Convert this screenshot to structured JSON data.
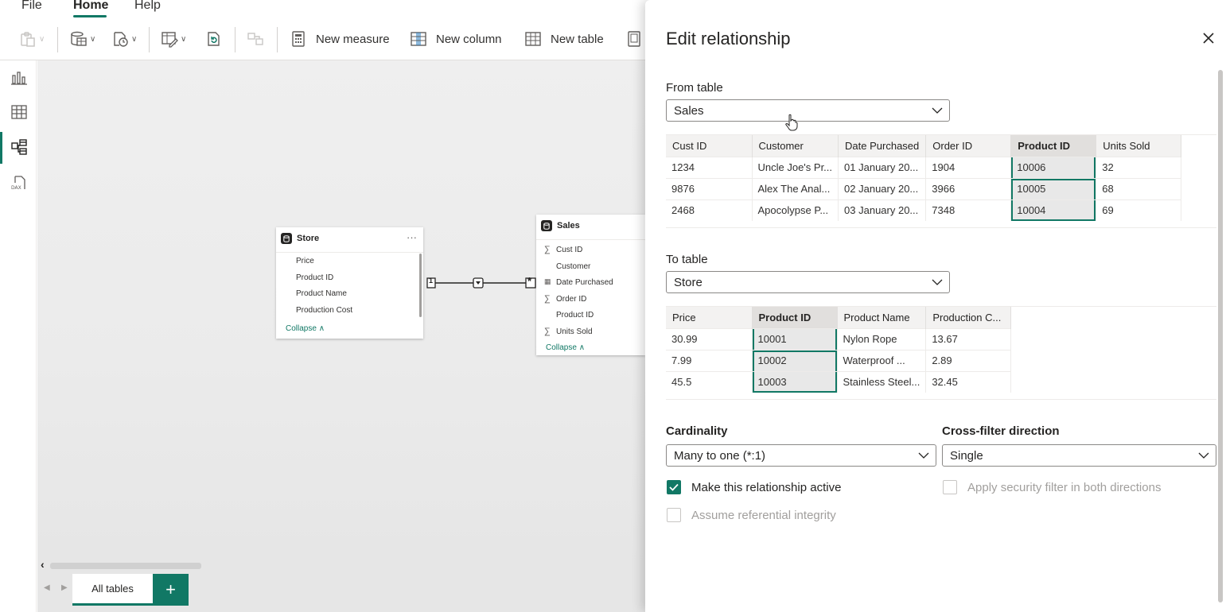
{
  "menu": {
    "file": "File",
    "home": "Home",
    "help": "Help"
  },
  "ribbon": {
    "new_measure": "New measure",
    "new_column": "New column",
    "new_table": "New table"
  },
  "model": {
    "store": {
      "title": "Store",
      "more": "···",
      "fields": [
        "Price",
        "Product ID",
        "Product Name",
        "Production Cost"
      ],
      "collapse": "Collapse ∧"
    },
    "sales": {
      "title": "Sales",
      "fields": [
        "Cust ID",
        "Customer",
        "Date Purchased",
        "Order ID",
        "Product ID",
        "Units Sold"
      ],
      "collapse": "Collapse ∧"
    },
    "relationship": {
      "one": "1",
      "many": "*"
    }
  },
  "bottom": {
    "tab": "All tables",
    "add": "+"
  },
  "dialog": {
    "title": "Edit relationship",
    "from_label": "From table",
    "from_value": "Sales",
    "from_columns": [
      "Cust ID",
      "Customer",
      "Date Purchased",
      "Order ID",
      "Product ID",
      "Units Sold"
    ],
    "from_rows": [
      [
        "1234",
        "Uncle Joe's Pr...",
        "01 January 20...",
        "1904",
        "10006",
        "32"
      ],
      [
        "9876",
        "Alex The Anal...",
        "02 January 20...",
        "3966",
        "10005",
        "68"
      ],
      [
        "2468",
        "Apocolypse P...",
        "03 January 20...",
        "7348",
        "10004",
        "69"
      ]
    ],
    "to_label": "To table",
    "to_value": "Store",
    "to_columns": [
      "Price",
      "Product ID",
      "Product Name",
      "Production C..."
    ],
    "to_rows": [
      [
        "30.99",
        "10001",
        "Nylon Rope",
        "13.67"
      ],
      [
        "7.99",
        "10002",
        "Waterproof ...",
        "2.89"
      ],
      [
        "45.5",
        "10003",
        "Stainless Steel...",
        "32.45"
      ]
    ],
    "cardinality_label": "Cardinality",
    "cardinality_value": "Many to one (*:1)",
    "crossfilter_label": "Cross-filter direction",
    "crossfilter_value": "Single",
    "active_label": "Make this relationship active",
    "active_checked": true,
    "integrity_label": "Assume referential integrity",
    "integrity_checked": false,
    "security_label": "Apply security filter in both directions",
    "security_checked": false
  },
  "colors": {
    "accent": "#117865",
    "dialog_bg": "#ffffff",
    "canvas_bg": "#ebebeb"
  }
}
